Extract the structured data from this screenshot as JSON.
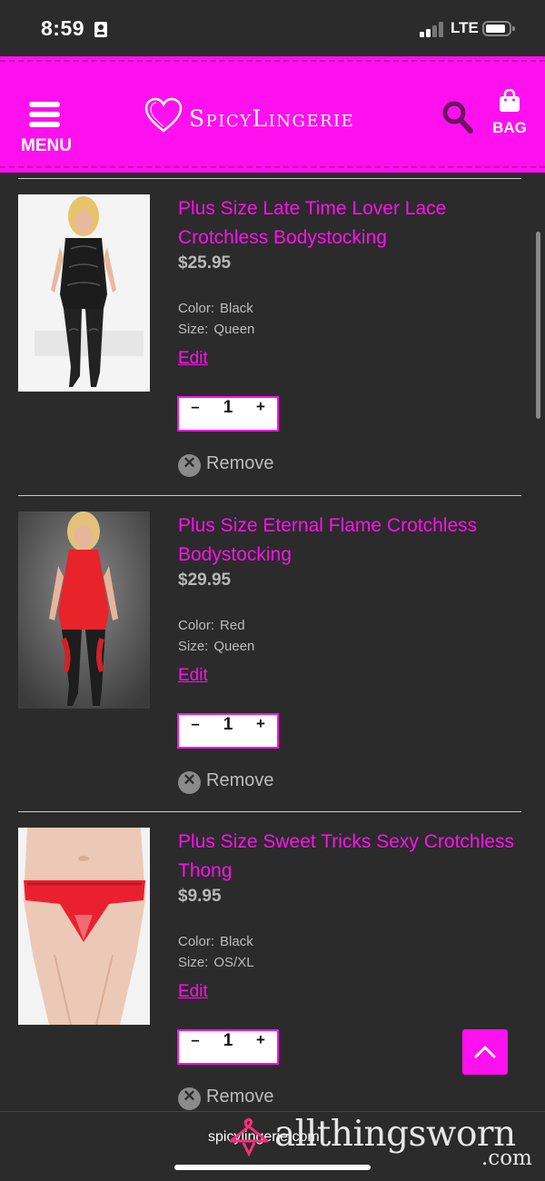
{
  "status_bar": {
    "time": "8:59",
    "network": "LTE",
    "icons": [
      "id-card-icon",
      "signal-icon",
      "battery-icon"
    ]
  },
  "header": {
    "menu_label": "MENU",
    "logo_text": "SpicyLingerie",
    "bag_label": "BAG",
    "icons": [
      "hamburger-icon",
      "heart-logo-icon",
      "search-icon",
      "bag-icon"
    ],
    "brand_color": "#ff10ee"
  },
  "cart": {
    "color_label": "Color:",
    "size_label": "Size:",
    "edit_label": "Edit",
    "remove_label": "Remove",
    "minus": "–",
    "plus": "+",
    "items": [
      {
        "name": "Plus Size Late Time Lover Lace Crotchless Bodystocking",
        "price": "$25.95",
        "color": "Black",
        "size": "Queen",
        "qty": "1"
      },
      {
        "name": "Plus Size Eternal Flame Crotchless Bodystocking",
        "price": "$29.95",
        "color": "Red",
        "size": "Queen",
        "qty": "1"
      },
      {
        "name": "Plus Size Sweet Tricks Sexy Crotchless Thong",
        "price": "$9.95",
        "color": "Black",
        "size": "OS/XL",
        "qty": "1"
      }
    ]
  },
  "browser": {
    "url": "spicylingerie.com"
  },
  "watermark": {
    "text": "allthingsworn",
    "suffix": ".com"
  }
}
